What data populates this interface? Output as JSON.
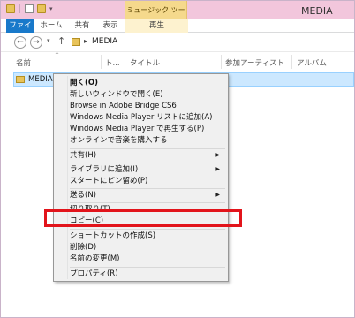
{
  "window": {
    "title": "MEDIA",
    "contextual_tab_group": "ミュージック ツール"
  },
  "ribbon": {
    "tabs": [
      {
        "label": "ファイル"
      },
      {
        "label": "ホーム"
      },
      {
        "label": "共有"
      },
      {
        "label": "表示"
      },
      {
        "label": "再生"
      }
    ]
  },
  "addressbar": {
    "path_segment": "MEDIA"
  },
  "columns": {
    "name": "名前",
    "number": "ト...",
    "title": "タイトル",
    "artist": "参加アーティスト",
    "album": "アルバム"
  },
  "files": [
    {
      "name": "MEDIA"
    }
  ],
  "context_menu": {
    "items": [
      {
        "label": "開く(O)"
      },
      {
        "label": "新しいウィンドウで開く(E)"
      },
      {
        "label": "Browse in Adobe Bridge CS6"
      },
      {
        "label": "Windows Media Player リストに追加(A)"
      },
      {
        "label": "Windows Media Player で再生する(P)"
      },
      {
        "label": "オンラインで音楽を購入する"
      },
      {
        "label": "共有(H)"
      },
      {
        "label": "ライブラリに追加(I)"
      },
      {
        "label": "スタートにピン留め(P)"
      },
      {
        "label": "送る(N)"
      },
      {
        "label": "切り取り(T)"
      },
      {
        "label": "コピー(C)"
      },
      {
        "label": "ショートカットの作成(S)"
      },
      {
        "label": "削除(D)"
      },
      {
        "label": "名前の変更(M)"
      },
      {
        "label": "プロパティ(R)"
      }
    ]
  },
  "colors": {
    "title_bar": "#f2c6dc",
    "file_tab": "#1979ca",
    "selection": "#cce8ff",
    "highlight_box": "#e2141b"
  }
}
